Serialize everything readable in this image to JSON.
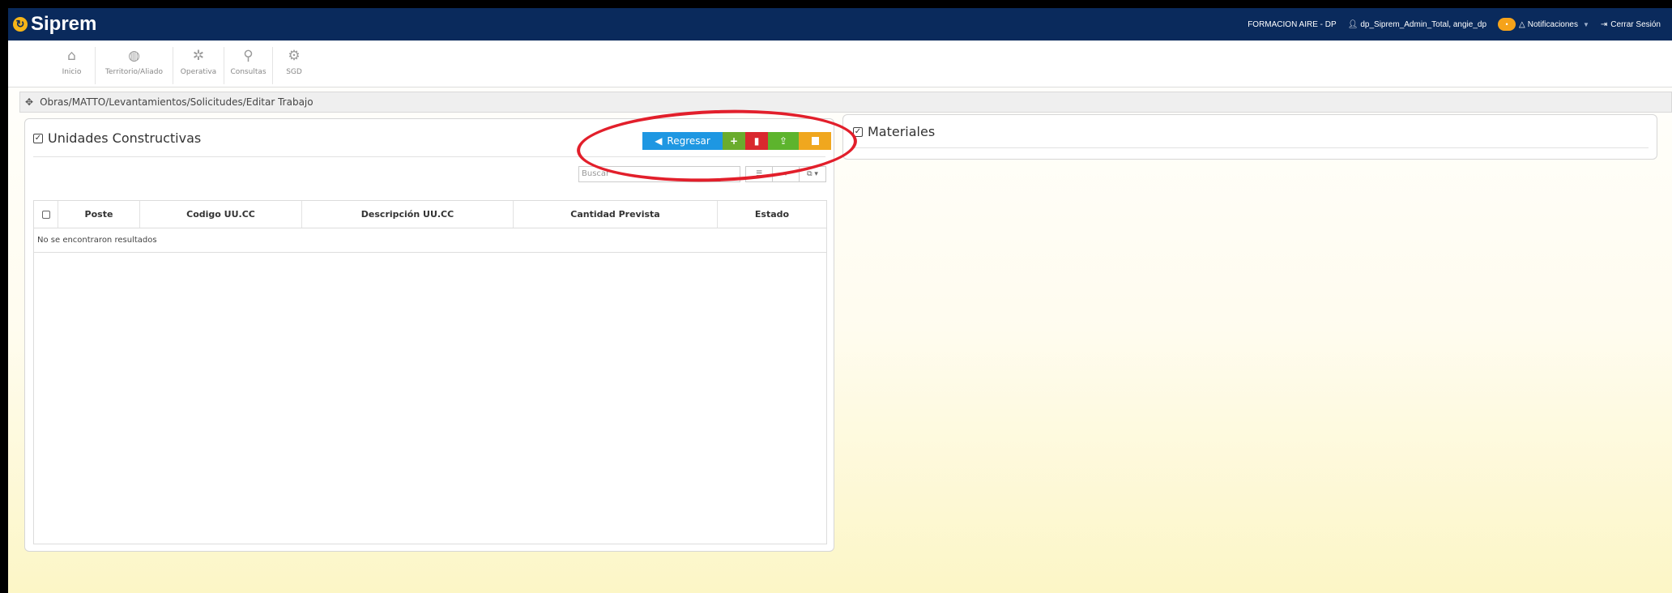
{
  "app": {
    "title": "Siprem"
  },
  "topbar": {
    "org": "FORMACION AIRE - DP",
    "user": "dp_Siprem_Admin_Total, angie_dp",
    "notifications_badge": "•",
    "notifications_label": "Notificaciones",
    "logout_label": "Cerrar Sesión"
  },
  "nav": {
    "items": [
      {
        "label": "Inicio",
        "icon": "home-icon"
      },
      {
        "label": "Territorio/Aliado",
        "icon": "globe-icon"
      },
      {
        "label": "Operativa",
        "icon": "gear-icon"
      },
      {
        "label": "Consultas",
        "icon": "search-icon"
      },
      {
        "label": "SGD",
        "icon": "gears-icon"
      }
    ]
  },
  "breadcrumb": {
    "path": "Obras/MATTO/Levantamientos/Solicitudes/Editar Trabajo"
  },
  "left_panel": {
    "title": "Unidades Constructivas",
    "buttons": {
      "back_label": "Regresar"
    },
    "search_placeholder": "Buscar",
    "table": {
      "columns": [
        "Poste",
        "Codigo UU.CC",
        "Descripción UU.CC",
        "Cantidad Prevista",
        "Estado"
      ],
      "empty_message": "No se encontraron resultados"
    }
  },
  "right_panel": {
    "title": "Materiales"
  },
  "colors": {
    "topbar": "#0a2a5c",
    "back_button": "#1e97e2",
    "add_button": "#6aac2d",
    "delete_button": "#d9282e",
    "upload_button": "#5db42d",
    "doc_button": "#f0a71e",
    "annotation": "#e21f2b"
  }
}
